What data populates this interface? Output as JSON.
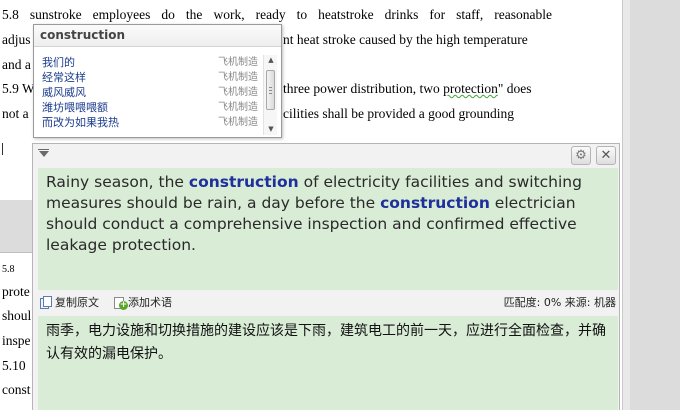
{
  "document": {
    "lines_top": [
      "5.8 sunstroke employees do the work, ready to heatstroke drinks for staff, reasonable",
      "adjus",
      "nt heat stroke caused by the high temperature",
      "and a",
      "5.9 W",
      "three power distribution, two ",
      "protection",
      "\" does",
      "not a",
      "cilities shall be provided a good grounding"
    ],
    "lines_bottom": [
      "5.8",
      "prote",
      "shoul",
      "inspe",
      "5.10",
      "const"
    ]
  },
  "suggestions": {
    "header": "construction",
    "items": [
      {
        "term": "我们的",
        "source": "飞机制造"
      },
      {
        "term": "经常这样",
        "source": "飞机制造"
      },
      {
        "term": "威风威风",
        "source": "飞机制造"
      },
      {
        "term": "潍坊喂喂喂额",
        "source": "飞机制造"
      },
      {
        "term": "而改为如果我热",
        "source": "飞机制造"
      }
    ]
  },
  "panel": {
    "settings_icon": "⚙",
    "close_icon": "✕",
    "source_segments": [
      "Rainy season, the ",
      "construction",
      " of electricity facilities and switching measures should be rain, a day before the ",
      "construction",
      " electrician should conduct a comprehensive inspection and confirmed effective leakage protection."
    ],
    "toolbar": {
      "copy_label": "复制原文",
      "add_term_label": "添加术语",
      "match_label": "匹配度: 0% 来源: 机器"
    },
    "target_text": "雨季，电力设施和切换措施的建设应该是下雨，建筑电工的前一天，应进行全面检查，并确认有效的漏电保护。"
  }
}
